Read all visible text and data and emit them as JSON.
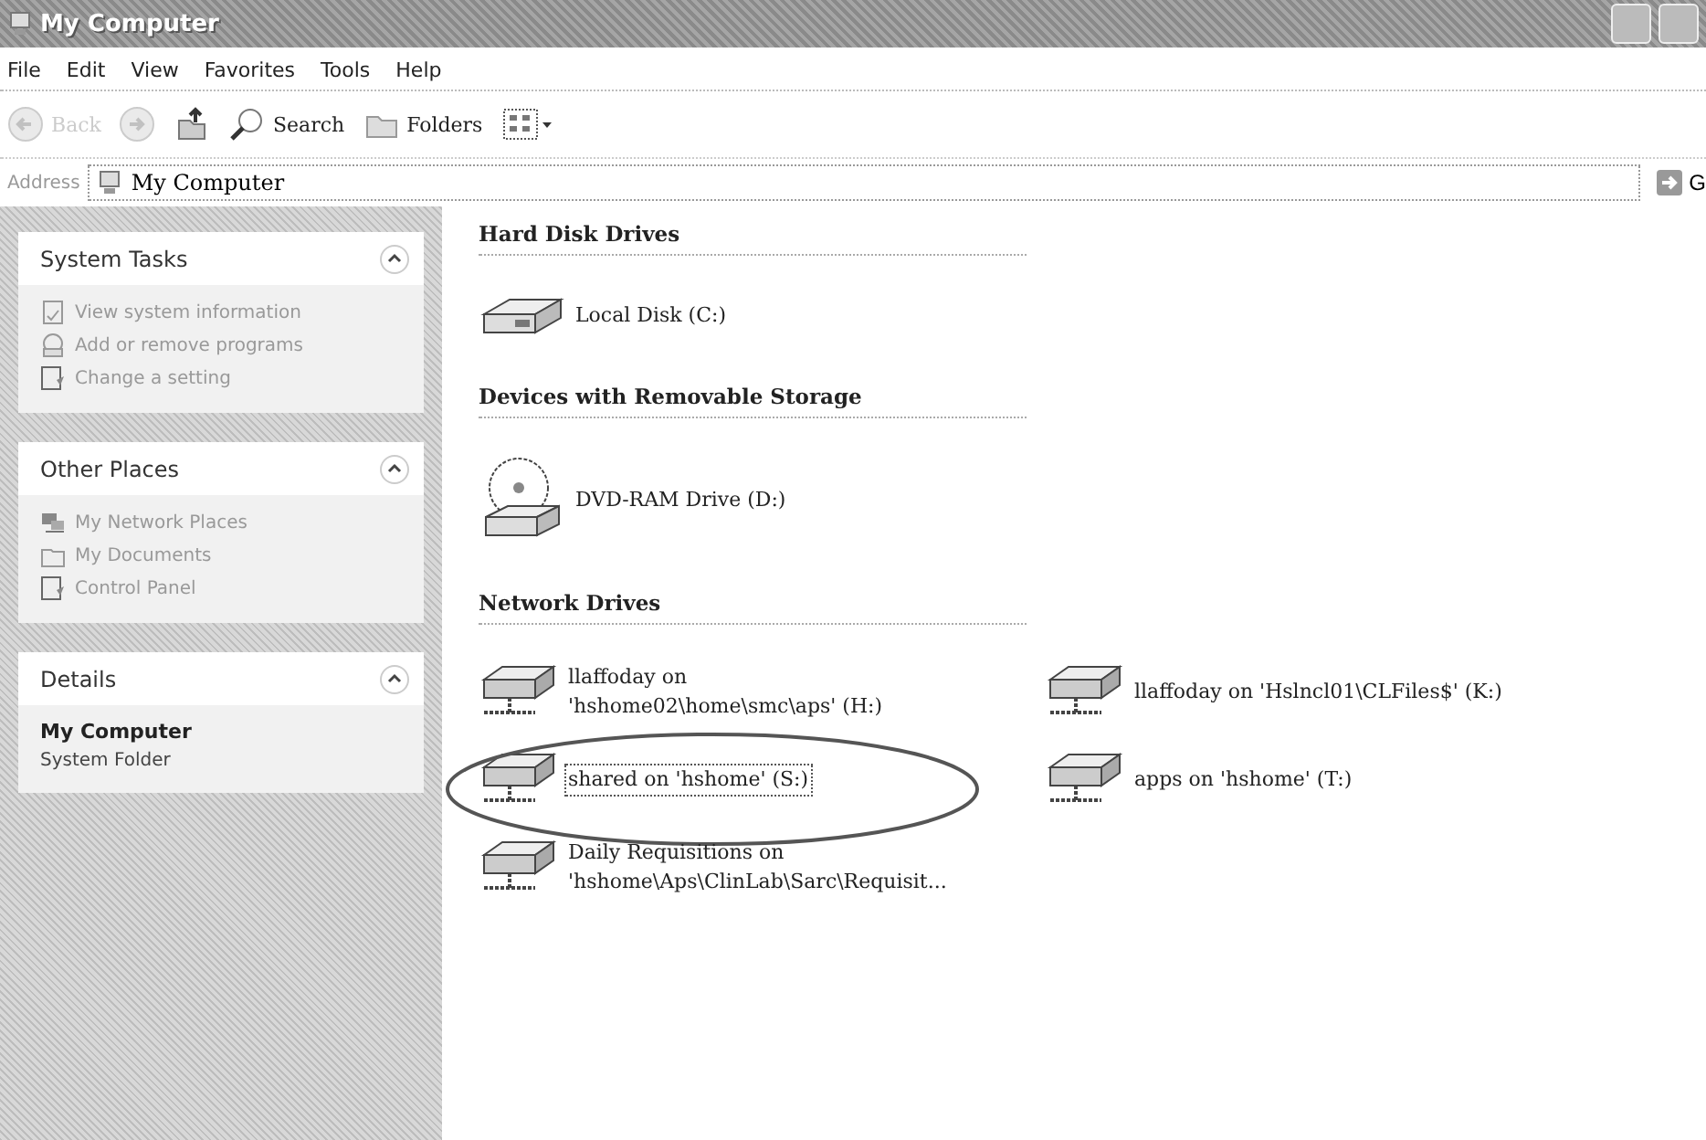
{
  "window": {
    "title": "My Computer"
  },
  "menu": [
    "File",
    "Edit",
    "View",
    "Favorites",
    "Tools",
    "Help"
  ],
  "toolbar": [
    {
      "kind": "back",
      "label": "Back",
      "disabled": true
    },
    {
      "kind": "forward",
      "disabled": true
    },
    {
      "kind": "up"
    },
    {
      "kind": "search",
      "label": "Search"
    },
    {
      "kind": "folders",
      "label": "Folders"
    },
    {
      "kind": "views"
    }
  ],
  "address": {
    "label": "Address",
    "value": "My Computer",
    "go": "G"
  },
  "panels": [
    {
      "title": "System Tasks",
      "expanded": true,
      "kind": "links",
      "items": [
        {
          "label": "View system information",
          "kind": "info"
        },
        {
          "label": "Add or remove programs",
          "kind": "cd"
        },
        {
          "label": "Change a setting",
          "kind": "panel"
        }
      ]
    },
    {
      "title": "Other Places",
      "expanded": true,
      "kind": "links",
      "items": [
        {
          "label": "My Network Places",
          "kind": "network"
        },
        {
          "label": "My Documents",
          "kind": "folder"
        },
        {
          "label": "Control Panel",
          "kind": "panel"
        }
      ]
    },
    {
      "title": "Details",
      "expanded": true,
      "kind": "details",
      "name": "My Computer",
      "type": "System Folder"
    }
  ],
  "groups": [
    {
      "title": "Hard Disk Drives",
      "items": [
        {
          "kind": "disk",
          "lines": [
            "Local Disk (C:)"
          ],
          "selected": false
        }
      ]
    },
    {
      "title": "Devices with Removable Storage",
      "items": [
        {
          "kind": "dvd",
          "lines": [
            "DVD-RAM Drive (D:)"
          ],
          "selected": false
        }
      ]
    },
    {
      "title": "Network Drives",
      "items": [
        {
          "kind": "net",
          "lines": [
            "llaffoday on",
            "'hshome02\\home\\smc\\aps' (H:)"
          ],
          "selected": false
        },
        {
          "kind": "net",
          "lines": [
            "llaffoday on 'Hslncl01\\CLFiles$' (K:)"
          ],
          "selected": false
        },
        {
          "kind": "net",
          "lines": [
            "shared on 'hshome' (S:)"
          ],
          "selected": true,
          "circled": true
        },
        {
          "kind": "net",
          "lines": [
            "apps on 'hshome' (T:)"
          ],
          "selected": false
        },
        {
          "kind": "net",
          "lines": [
            "Daily Requisitions on",
            "'hshome\\Aps\\ClinLab\\Sarc\\Requisit..."
          ],
          "selected": false
        }
      ]
    }
  ]
}
